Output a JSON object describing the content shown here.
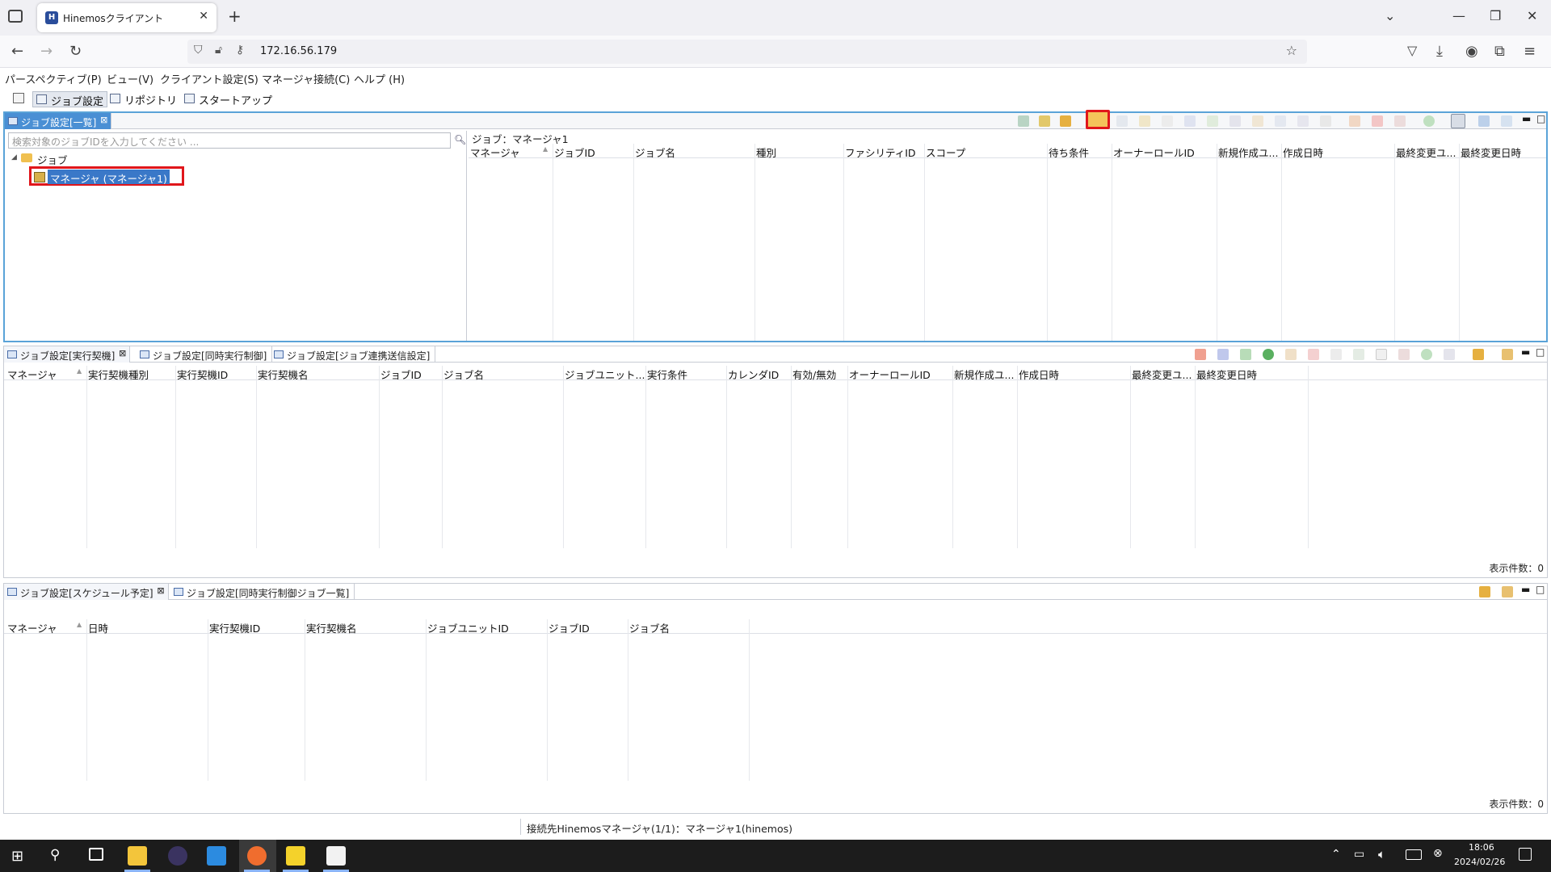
{
  "browser": {
    "tab_title": "Hinemosクライアント",
    "url": "172.16.56.179"
  },
  "menu": [
    "パースペクティブ(P)",
    "ビュー(V)",
    "クライアント設定(S)",
    "マネージャ接続(C)",
    "ヘルプ (H)"
  ],
  "perspectives": [
    "ジョブ設定",
    "リポジトリ",
    "スタートアップ"
  ],
  "top_panel": {
    "tab": "ジョブ設定[一覧]",
    "search_placeholder": "検索対象のジョブIDを入力してください ...",
    "tree_root": "ジョブ",
    "tree_item": "マネージャ (マネージャ1)",
    "detail_title": "ジョブ：マネージャ1",
    "columns": [
      "マネージャ",
      "ジョブID",
      "ジョブ名",
      "種別",
      "ファシリティID",
      "スコープ",
      "待ち条件",
      "オーナーロールID",
      "新規作成ユ...",
      "作成日時",
      "最終変更ユ...",
      "最終変更日時"
    ]
  },
  "mid_panel": {
    "tabs": [
      "ジョブ設定[実行契機]",
      "ジョブ設定[同時実行制御]",
      "ジョブ設定[ジョブ連携送信設定]"
    ],
    "columns": [
      "マネージャ",
      "実行契機種別",
      "実行契機ID",
      "実行契機名",
      "ジョブID",
      "ジョブ名",
      "ジョブユニット...",
      "実行条件",
      "カレンダID",
      "有効/無効",
      "オーナーロールID",
      "新規作成ユ...",
      "作成日時",
      "最終変更ユ...",
      "最終変更日時"
    ],
    "count": "表示件数：0"
  },
  "bottom_panel": {
    "tabs": [
      "ジョブ設定[スケジュール予定]",
      "ジョブ設定[同時実行制御ジョブ一覧]"
    ],
    "columns": [
      "マネージャ",
      "日時",
      "実行契機ID",
      "実行契機名",
      "ジョブユニットID",
      "ジョブID",
      "ジョブ名"
    ],
    "count": "表示件数：0"
  },
  "status": "接続先Hinemosマネージャ(1/1)：マネージャ1(hinemos)",
  "clock": {
    "time": "18:06",
    "date": "2024/02/26"
  }
}
